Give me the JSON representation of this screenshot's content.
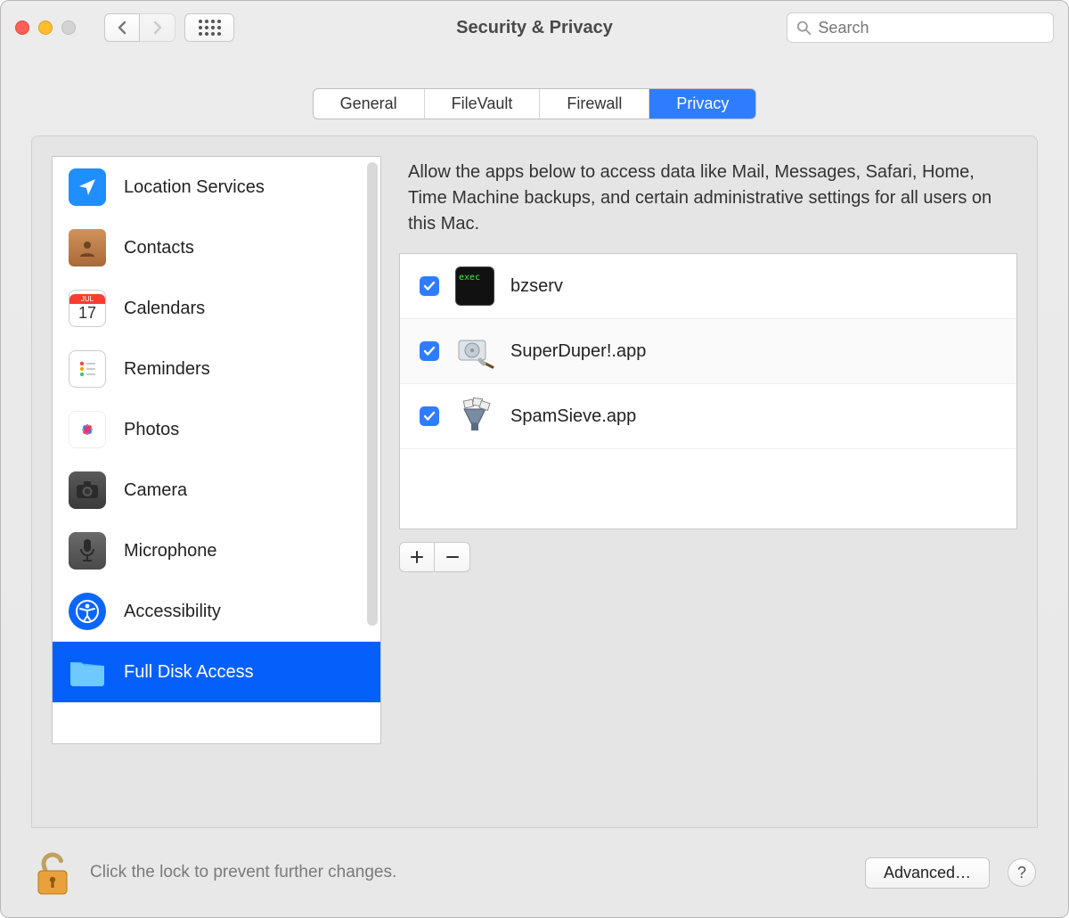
{
  "window": {
    "title": "Security & Privacy"
  },
  "search": {
    "placeholder": "Search"
  },
  "tabs": [
    {
      "label": "General",
      "active": false
    },
    {
      "label": "FileVault",
      "active": false
    },
    {
      "label": "Firewall",
      "active": false
    },
    {
      "label": "Privacy",
      "active": true
    }
  ],
  "sidebar": {
    "items": [
      {
        "label": "Location Services",
        "icon": "location-arrow",
        "selected": false
      },
      {
        "label": "Contacts",
        "icon": "contacts-book",
        "selected": false
      },
      {
        "label": "Calendars",
        "icon": "calendar-17",
        "selected": false
      },
      {
        "label": "Reminders",
        "icon": "reminders-list",
        "selected": false
      },
      {
        "label": "Photos",
        "icon": "photos-flower",
        "selected": false
      },
      {
        "label": "Camera",
        "icon": "camera",
        "selected": false
      },
      {
        "label": "Microphone",
        "icon": "microphone",
        "selected": false
      },
      {
        "label": "Accessibility",
        "icon": "accessibility",
        "selected": false
      },
      {
        "label": "Full Disk Access",
        "icon": "folder",
        "selected": true
      }
    ]
  },
  "main": {
    "description": "Allow the apps below to access data like Mail, Messages, Safari, Home, Time Machine backups, and certain administrative settings for all users on this Mac.",
    "apps": [
      {
        "name": "bzserv",
        "checked": true,
        "icon": "terminal-exec"
      },
      {
        "name": "SuperDuper!.app",
        "checked": true,
        "icon": "disk-clone"
      },
      {
        "name": "SpamSieve.app",
        "checked": true,
        "icon": "spam-sieve"
      }
    ]
  },
  "footer": {
    "lock_text": "Click the lock to prevent further changes.",
    "advanced_label": "Advanced…"
  }
}
